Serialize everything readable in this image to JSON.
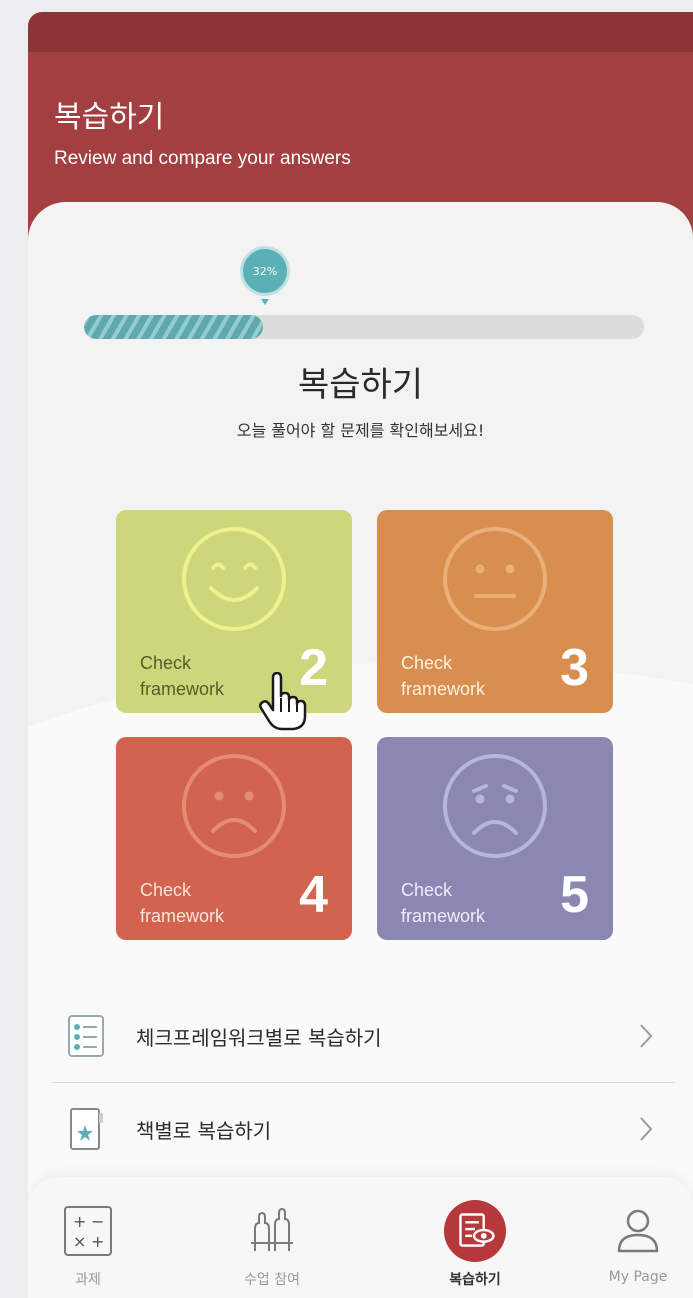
{
  "header": {
    "title": "복습하기",
    "subtitle": "Review and compare your answers"
  },
  "progress": {
    "percent_label": "32%",
    "value": 0.32
  },
  "main": {
    "title": "복습하기",
    "subtitle": "오늘 풀어야 할 문제를 확인해보세요!"
  },
  "tiles": [
    {
      "label": "Check framework",
      "number": "2",
      "face": "smile-icon",
      "color": "#cdd67a",
      "text_color": "#5a5a2e"
    },
    {
      "label": "Check framework",
      "number": "3",
      "face": "neutral-face-icon",
      "color": "#d88e4f",
      "text_color": "#fff1e0"
    },
    {
      "label": "Check framework",
      "number": "4",
      "face": "sad-face-icon",
      "color": "#d2634f",
      "text_color": "#ffe4dd"
    },
    {
      "label": "Check framework",
      "number": "5",
      "face": "worried-face-icon",
      "color": "#8a88b2",
      "text_color": "#eeedfa"
    }
  ],
  "list": [
    {
      "label": "체크프레임워크별로 복습하기",
      "icon": "checklist-icon"
    },
    {
      "label": "책별로 복습하기",
      "icon": "book-icon"
    }
  ],
  "nav": [
    {
      "label": "과제",
      "icon": "math-operators-icon",
      "active": false
    },
    {
      "label": "수업 참여",
      "icon": "raised-hands-icon",
      "active": false
    },
    {
      "label": "복습하기",
      "icon": "review-eye-icon",
      "active": true
    },
    {
      "label": "My Page",
      "icon": "user-icon",
      "active": false
    }
  ],
  "colors": {
    "header": "#a23f41",
    "status_bar": "#8c3539",
    "accent_teal": "#5ab0b4",
    "nav_active": "#b8393c"
  }
}
